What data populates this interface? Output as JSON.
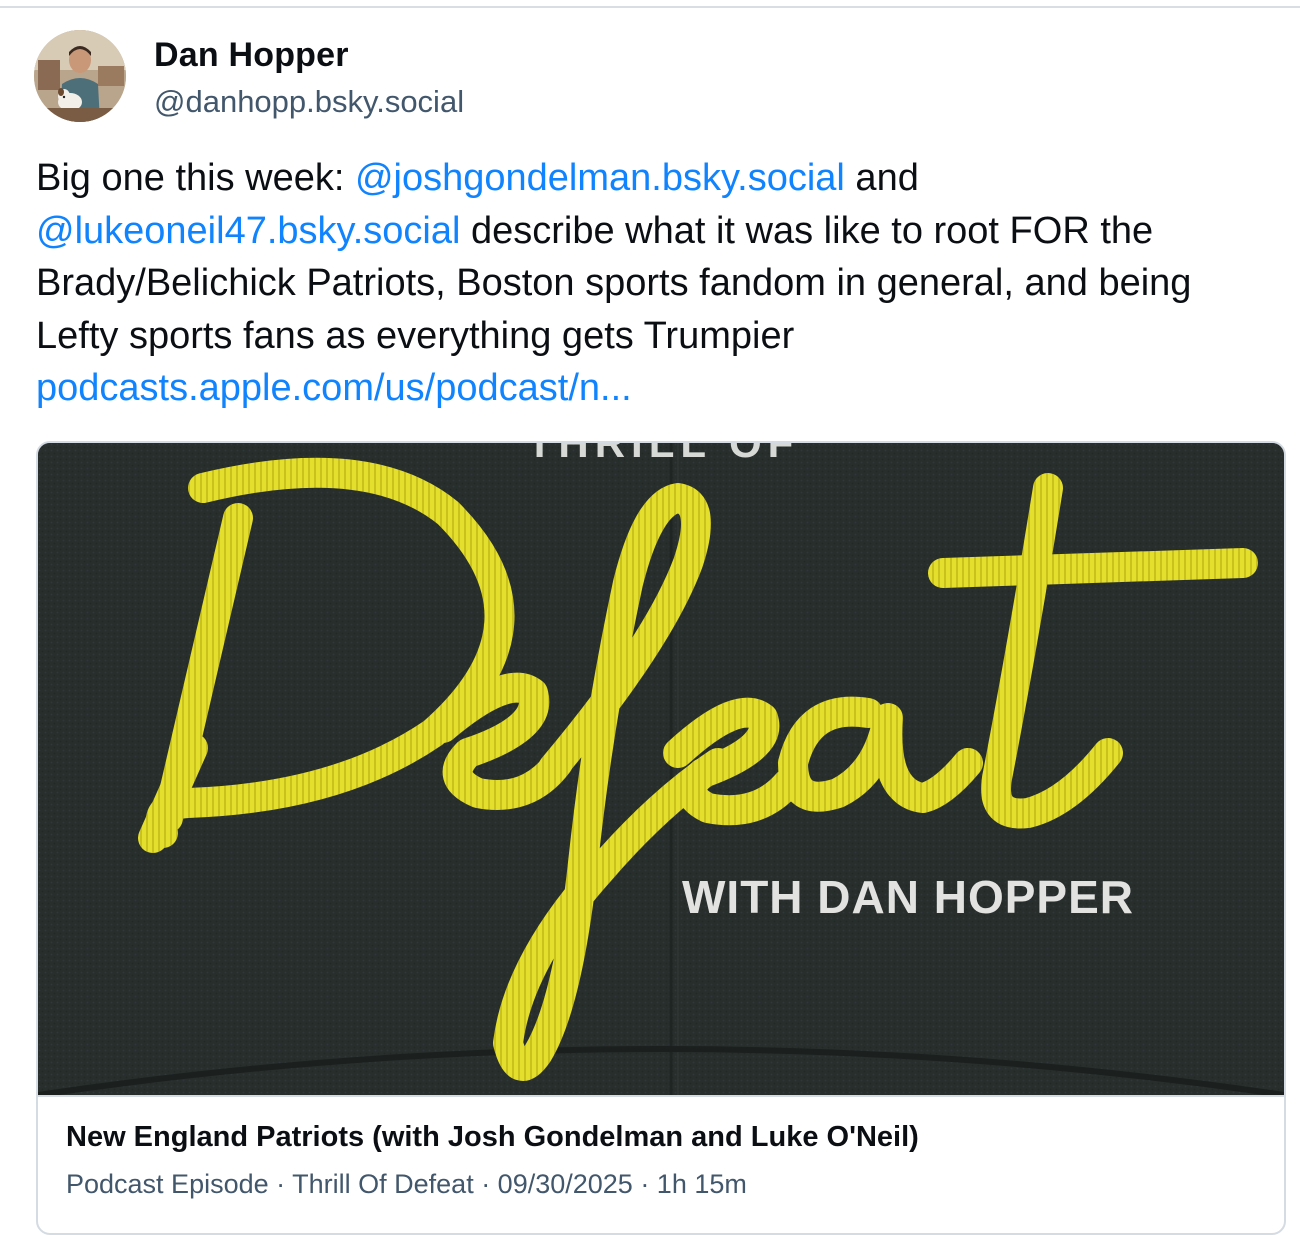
{
  "author": {
    "display_name": "Dan Hopper",
    "handle": "@danhopp.bsky.social",
    "avatar_icon": "profile-photo-with-dog"
  },
  "post": {
    "text_intro": "Big one this week: ",
    "mention_1": "@joshgondelman.bsky.social",
    "text_and": " and ",
    "mention_2": "@lukeoneil47.bsky.social",
    "text_body": " describe what it was like to root FOR the Brady/Belichick Patriots, Boston sports fandom in general, and being Lefty sports fans as everything gets Trumpier",
    "link_text": "podcasts.apple.com/us/podcast/n..."
  },
  "embed": {
    "thumbnail": {
      "script_word": "Defeat",
      "subtitle": "WITH DAN HOPPER",
      "cropped_top_text": "THRILL OF"
    },
    "title": "New England Patriots (with Josh Gondelman and Luke O'Neil)",
    "description": "Podcast Episode · Thrill Of Defeat · 09/30/2025 · 1h 15m"
  },
  "colors": {
    "link": "#1083fe",
    "secondary_text": "#42576c",
    "thumb_background": "#272d2b",
    "script_yellow": "#e6df2b"
  }
}
